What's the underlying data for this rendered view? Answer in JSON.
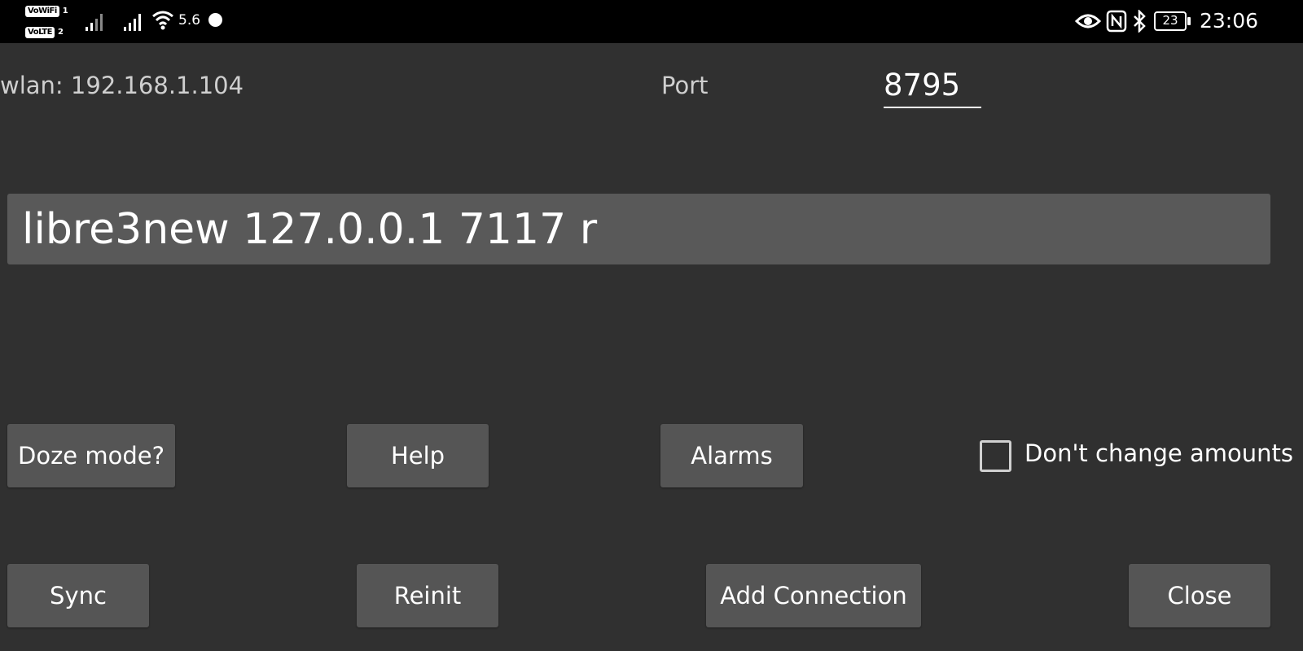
{
  "status_bar": {
    "vowifi_badge": "VoWiFi",
    "vowifi_sim": "1",
    "volte_badge": "VoLTE",
    "volte_sim": "2",
    "network_speed": "5.6",
    "battery_level": "23",
    "time": "23:06",
    "icons": [
      "signal-icon",
      "signal-icon",
      "wifi-icon",
      "record-dot-icon",
      "eye-icon",
      "nfc-icon",
      "bluetooth-icon",
      "battery-icon"
    ]
  },
  "connection": {
    "wlan_text": "wlan: 192.168.1.104",
    "port_label": "Port",
    "port_value": "8795"
  },
  "command_field": {
    "value": "libre3new 127.0.0.1 7117 r"
  },
  "buttons": {
    "doze": "Doze mode?",
    "help": "Help",
    "alarms": "Alarms",
    "sync": "Sync",
    "reinit": "Reinit",
    "add_connection": "Add Connection",
    "close": "Close"
  },
  "dont_change_amounts": {
    "label": "Don't change amounts",
    "checked": false
  },
  "colors": {
    "background": "#303030",
    "status_bar": "#000000",
    "button": "#555555",
    "field": "#595959",
    "text": "#ffffff"
  }
}
